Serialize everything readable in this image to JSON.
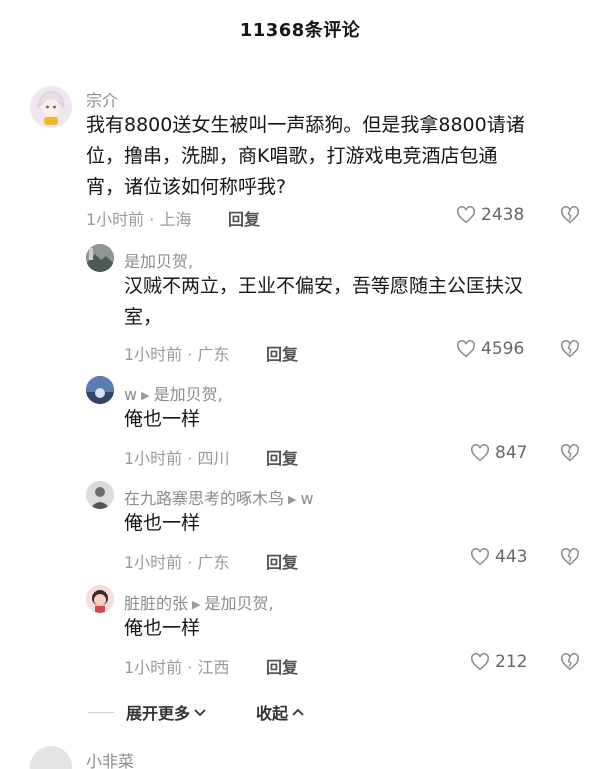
{
  "header": {
    "title": "11368条评论"
  },
  "comment": {
    "username": "宗介",
    "lines": [
      "我有8800送女生被叫一声舔狗。但是我拿8800请诸",
      "位，撸串，洗脚，商K唱歌，打游戏电竞酒店包通",
      "宵，诸位该如何称呼我?"
    ],
    "time_location": "1小时前 · 上海",
    "reply_label": "回复",
    "likes": "2438"
  },
  "replies": [
    {
      "username": "是加贝贺,",
      "reply_to": "",
      "lines": [
        "汉贼不两立，王业不偏安，吾等愿随主公匡扶汉",
        "室，"
      ],
      "time_location": "1小时前 · 广东",
      "reply_label": "回复",
      "likes": "4596"
    },
    {
      "username": "w",
      "reply_to": "是加贝贺,",
      "lines": [
        "俺也一样"
      ],
      "time_location": "1小时前 · 四川",
      "reply_label": "回复",
      "likes": "847"
    },
    {
      "username": "在九路寨思考的啄木鸟",
      "reply_to": "w",
      "lines": [
        "俺也一样"
      ],
      "time_location": "1小时前 · 广东",
      "reply_label": "回复",
      "likes": "443"
    },
    {
      "username": "脏脏的张",
      "reply_to": "是加贝贺,",
      "lines": [
        "俺也一样"
      ],
      "time_location": "1小时前 · 江西",
      "reply_label": "回复",
      "likes": "212"
    }
  ],
  "footer": {
    "expand_label": "展开更多",
    "collapse_label": "收起",
    "next_username": "小非菜"
  },
  "colors": {
    "text": "#161616",
    "meta": "#9a9a9a",
    "background": "#ffffff"
  },
  "icons": [
    "heart-icon",
    "broken-heart-icon",
    "chevron-down-icon",
    "chevron-up-icon",
    "play-arrow-icon"
  ]
}
